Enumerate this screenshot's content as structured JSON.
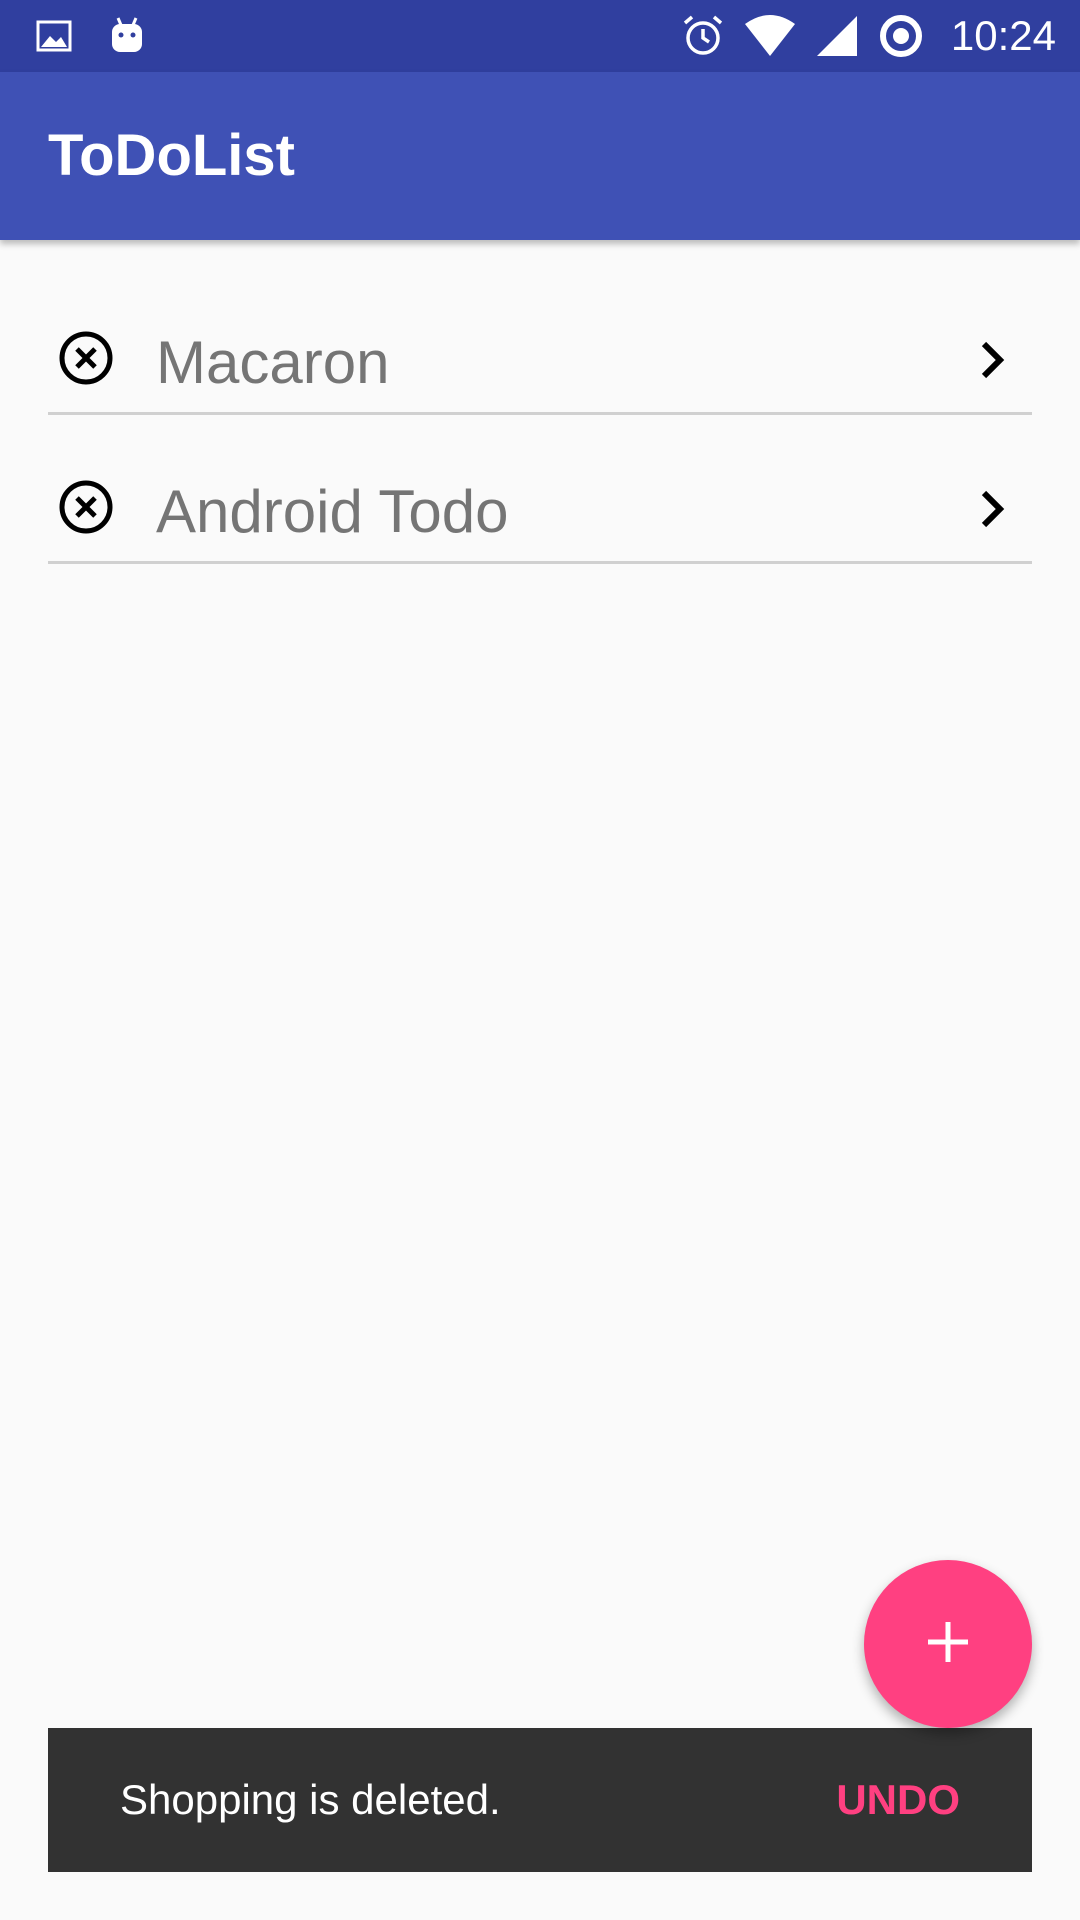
{
  "status_bar": {
    "time": "10:24",
    "icons_left": [
      "gallery-icon",
      "android-icon"
    ],
    "icons_right": [
      "alarm-icon",
      "wifi-icon",
      "signal-icon",
      "sync-icon"
    ]
  },
  "app_bar": {
    "title": "ToDoList",
    "color": "#3f51b5"
  },
  "todo_items": [
    {
      "label": "Macaron"
    },
    {
      "label": "Android Todo"
    }
  ],
  "fab": {
    "icon": "plus-icon",
    "color": "#ff4081"
  },
  "snackbar": {
    "message": "Shopping is deleted.",
    "action_label": "UNDO",
    "action_color": "#ff4081"
  }
}
